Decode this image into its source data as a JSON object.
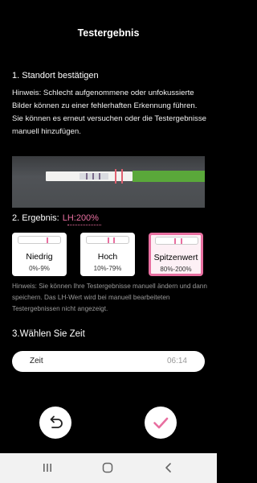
{
  "header": {
    "title": "Testergebnis"
  },
  "section1": {
    "heading": "1. Standort bestätigen",
    "hint": "Hinweis: Schlecht aufgenommene oder unfokussierte Bilder können zu einer fehlerhaften Erkennung führen. Sie können es erneut versuchen oder die Testergebnisse manuell hinzufügen."
  },
  "section2": {
    "heading": "2. Ergebnis:",
    "result": "LH:200%",
    "options": [
      {
        "label": "Niedrig",
        "range": "0%-9%",
        "selected": false
      },
      {
        "label": "Hoch",
        "range": "10%-79%",
        "selected": false
      },
      {
        "label": "Spitzenwert",
        "range": "80%-200%",
        "selected": true
      }
    ],
    "note": "Hinweis: Sie können Ihre Testergebnisse manuell ändern und dann speichern. Das LH-Wert wird bei manuell bearbeiteten Testergebnissen nicht angezeigt."
  },
  "section3": {
    "heading": "3.Wählen Sie Zeit",
    "time_label": "Zeit",
    "time_value": "06:14"
  },
  "actions": {
    "back_icon": "undo-arrow-icon",
    "confirm_icon": "checkmark-icon"
  },
  "colors": {
    "accent": "#e86fa0",
    "background": "#000000"
  }
}
